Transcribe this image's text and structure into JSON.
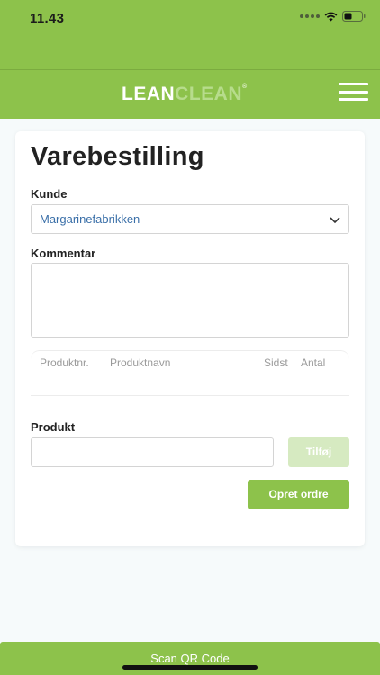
{
  "status_bar": {
    "time": "11.43"
  },
  "header": {
    "logo_part1": "LEAN",
    "logo_part2": "CLEAN",
    "logo_mark": "®"
  },
  "form": {
    "title": "Varebestilling",
    "customer_label": "Kunde",
    "customer_value": "Margarinefabrikken",
    "comment_label": "Kommentar",
    "comment_value": "",
    "table_columns": [
      "Produktnr.",
      "Produktnavn",
      "Sidst",
      "Antal"
    ],
    "product_label": "Produkt",
    "product_value": "",
    "add_button": "Tilføj",
    "create_order_button": "Opret ordre"
  },
  "bottom_bar": {
    "scan_label": "Scan QR Code"
  },
  "colors": {
    "brand_green": "#8dc24b",
    "disabled_green": "#d6eac1",
    "link_blue": "#3a6fa8"
  }
}
